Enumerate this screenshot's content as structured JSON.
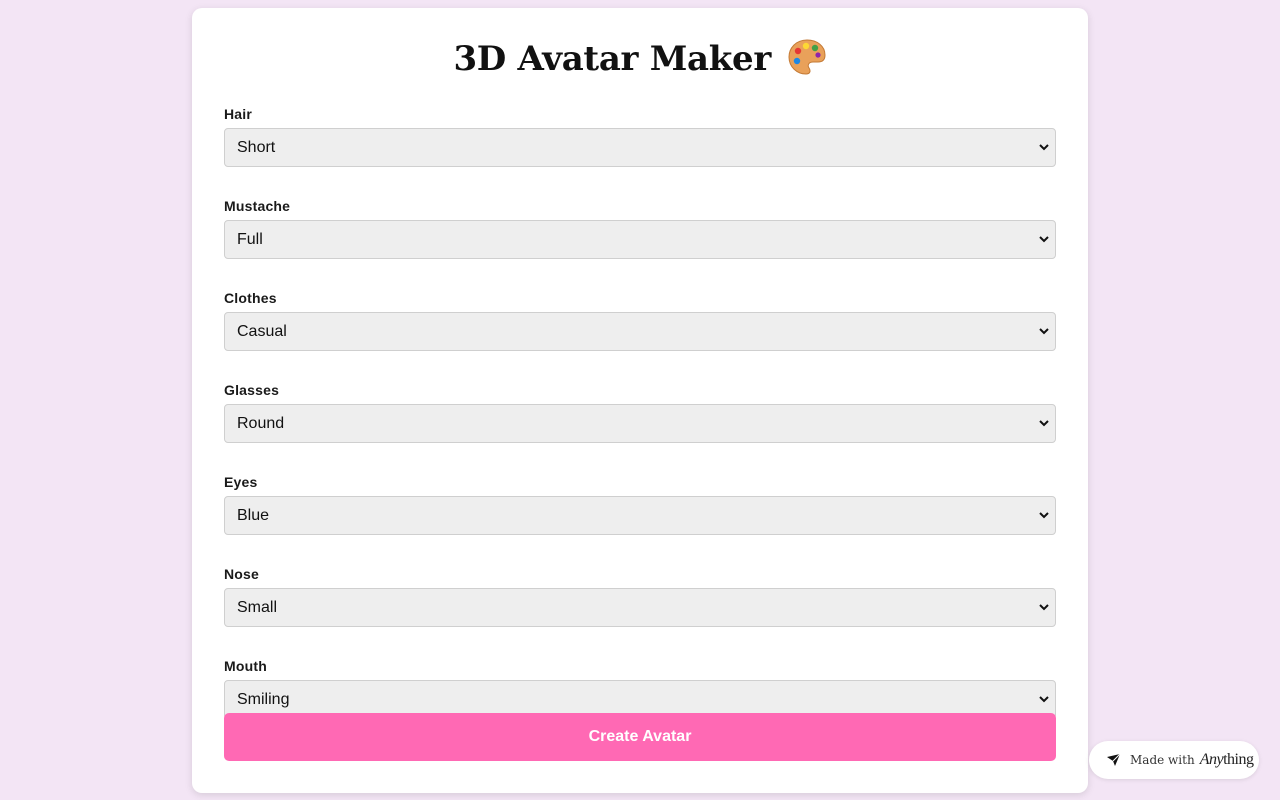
{
  "app": {
    "title": "3D Avatar Maker"
  },
  "form": {
    "fields": [
      {
        "label": "Hair",
        "value": "Short"
      },
      {
        "label": "Mustache",
        "value": "Full"
      },
      {
        "label": "Clothes",
        "value": "Casual"
      },
      {
        "label": "Glasses",
        "value": "Round"
      },
      {
        "label": "Eyes",
        "value": "Blue"
      },
      {
        "label": "Nose",
        "value": "Small"
      },
      {
        "label": "Mouth",
        "value": "Smiling"
      }
    ],
    "submit_label": "Create Avatar"
  },
  "badge": {
    "prefix": "Made with",
    "brand_italic": "Any",
    "brand_rest": "thing"
  },
  "colors": {
    "background": "#f3e5f5",
    "accent": "#ff69b4",
    "card": "#ffffff",
    "select_bg": "#eeeeee"
  },
  "icons": {
    "title_icon": "palette-icon",
    "select_icon": "chevron-down-icon",
    "badge_icon": "anything-logo-icon"
  }
}
